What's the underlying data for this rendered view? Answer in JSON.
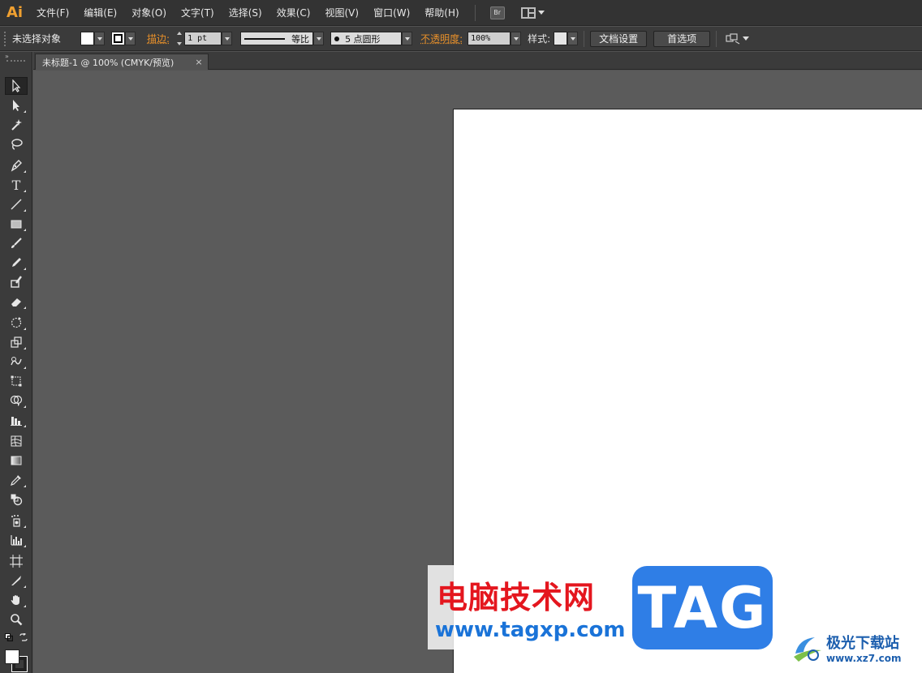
{
  "app": {
    "logo": "Ai",
    "bridge_label": "Br"
  },
  "menu": [
    {
      "name": "file",
      "label": "文件(F)"
    },
    {
      "name": "edit",
      "label": "编辑(E)"
    },
    {
      "name": "object",
      "label": "对象(O)"
    },
    {
      "name": "type",
      "label": "文字(T)"
    },
    {
      "name": "select",
      "label": "选择(S)"
    },
    {
      "name": "effect",
      "label": "效果(C)"
    },
    {
      "name": "view",
      "label": "视图(V)"
    },
    {
      "name": "window",
      "label": "窗口(W)"
    },
    {
      "name": "help",
      "label": "帮助(H)"
    }
  ],
  "control": {
    "selection_status": "未选择对象",
    "stroke_label": "描边:",
    "stroke_weight": "1 pt",
    "stroke_profile": "等比",
    "brush": "5 点圆形",
    "opacity_label": "不透明度:",
    "opacity_value": "100%",
    "style_label": "样式:",
    "doc_setup_button": "文档设置",
    "preferences_button": "首选项"
  },
  "document": {
    "tab_title": "未标题-1 @ 100% (CMYK/预览)",
    "close_glyph": "×"
  },
  "tools": [
    {
      "name": "selection-tool-icon",
      "active": true
    },
    {
      "name": "direct-selection-tool-icon"
    },
    {
      "name": "magic-wand-tool-icon"
    },
    {
      "name": "lasso-tool-icon"
    },
    {
      "name": "pen-tool-icon"
    },
    {
      "name": "type-tool-icon",
      "glyph": "T"
    },
    {
      "name": "line-tool-icon"
    },
    {
      "name": "rectangle-tool-icon"
    },
    {
      "name": "paintbrush-tool-icon"
    },
    {
      "name": "pencil-tool-icon"
    },
    {
      "name": "blob-brush-tool-icon"
    },
    {
      "name": "eraser-tool-icon"
    },
    {
      "name": "rotate-tool-icon"
    },
    {
      "name": "scale-tool-icon"
    },
    {
      "name": "warp-tool-icon"
    },
    {
      "name": "free-transform-tool-icon"
    },
    {
      "name": "shape-builder-tool-icon"
    },
    {
      "name": "graph-tool-icon"
    },
    {
      "name": "mesh-tool-icon"
    },
    {
      "name": "gradient-tool-icon"
    },
    {
      "name": "eyedropper-tool-icon"
    },
    {
      "name": "blend-tool-icon"
    },
    {
      "name": "symbol-sprayer-tool-icon"
    },
    {
      "name": "column-graph-tool-icon"
    },
    {
      "name": "artboard-tool-icon"
    },
    {
      "name": "slice-tool-icon"
    },
    {
      "name": "hand-tool-icon"
    },
    {
      "name": "zoom-tool-icon"
    }
  ],
  "watermark": {
    "cn_text": "电脑技术网",
    "url": "www.tagxp.com",
    "tag": "TAG",
    "site_cn": "极光下载站",
    "site_url": "www.xz7.com"
  },
  "colors": {
    "accent_orange": "#e8902a",
    "tag_blue": "#2f7ee6",
    "watermark_red": "#e4161e"
  }
}
